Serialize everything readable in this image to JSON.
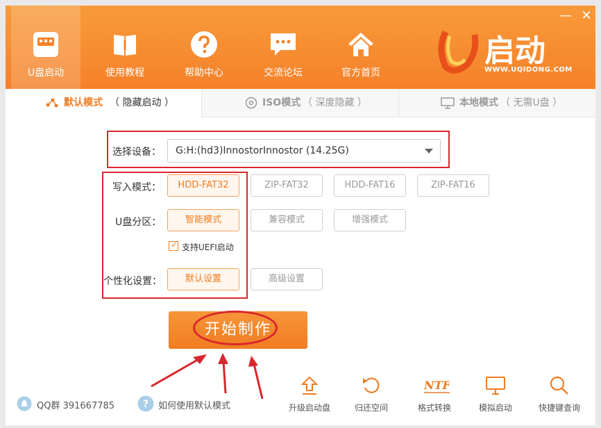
{
  "window": {
    "minimize_label": "—",
    "close_label": "✕"
  },
  "nav": [
    {
      "label": "U盘启动",
      "icon": "usb-drive-icon"
    },
    {
      "label": "使用教程",
      "icon": "book-icon"
    },
    {
      "label": "帮助中心",
      "icon": "help-icon"
    },
    {
      "label": "交流论坛",
      "icon": "chat-bubble-icon"
    },
    {
      "label": "官方首页",
      "icon": "home-icon"
    }
  ],
  "logo": {
    "text": "U启动",
    "sub": "WWW.UQIDONG.COM"
  },
  "tabs": [
    {
      "label": "默认模式",
      "sub": "（ 隐藏启动 ）",
      "icon": "share-nodes-icon"
    },
    {
      "label": "ISO模式",
      "sub": "（ 深度隐藏 ）",
      "icon": "disc-icon"
    },
    {
      "label": "本地模式",
      "sub": "（ 无需U盘 ）",
      "icon": "monitor-icon"
    }
  ],
  "form": {
    "device_label": "选择设备：",
    "device_value": "G:H:(hd3)InnostorInnostor (14.25G)",
    "write_mode_label": "写入模式：",
    "write_modes": [
      "HDD-FAT32",
      "ZIP-FAT32",
      "HDD-FAT16",
      "ZIP-FAT16"
    ],
    "partition_label": "U盘分区：",
    "partitions": [
      "智能模式",
      "兼容模式",
      "增强模式"
    ],
    "uefi_label": "支持UEFI启动",
    "uefi_checked": true,
    "personal_label": "个性化设置：",
    "personal_options": [
      "默认设置",
      "高级设置"
    ]
  },
  "start_label": "开始制作",
  "footer": {
    "qq": "QQ群 391667785",
    "help": "如何使用默认模式",
    "tools": [
      {
        "label": "升级启动盘",
        "icon": "upgrade-icon"
      },
      {
        "label": "归还空间",
        "icon": "restore-icon"
      },
      {
        "label": "格式转换",
        "icon": "ntfs-icon",
        "glyph": "NTFS"
      },
      {
        "label": "模拟启动",
        "icon": "monitor-icon"
      },
      {
        "label": "快捷键查询",
        "icon": "search-icon"
      }
    ]
  },
  "colors": {
    "accent": "#f07c22",
    "header": "#f5812a",
    "annotation": "#d8272d"
  }
}
